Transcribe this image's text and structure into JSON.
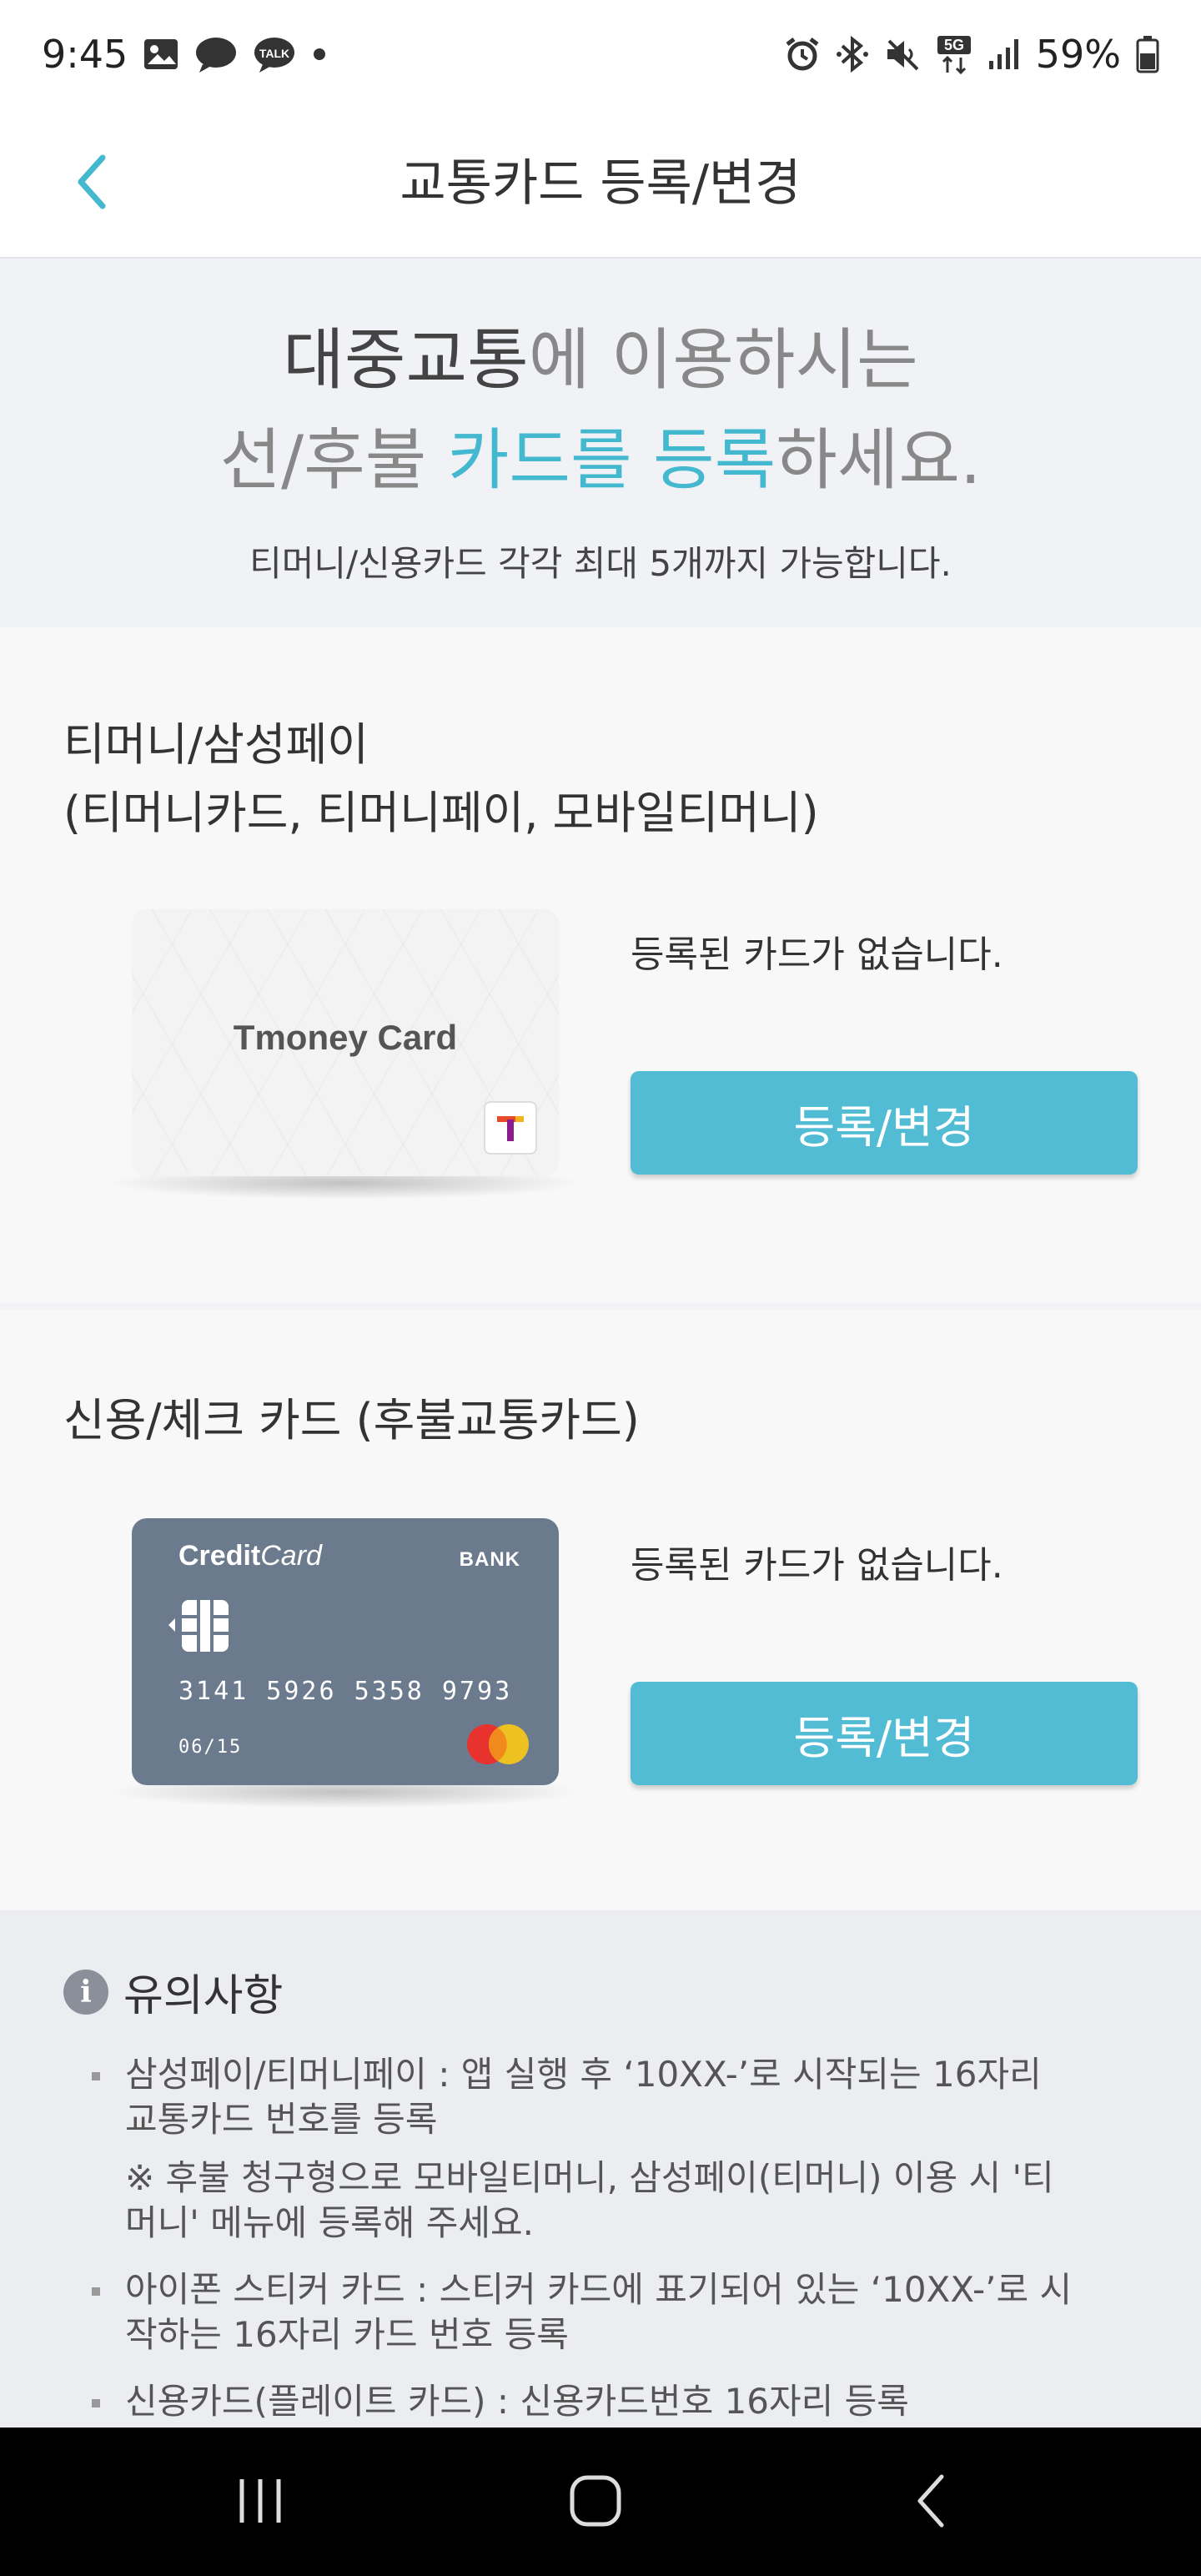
{
  "status_bar": {
    "time": "9:45",
    "battery": "59%",
    "network": "5G",
    "icons": [
      "gallery-icon",
      "chat-bubble-icon",
      "kakaotalk-icon",
      "notification-dot-icon",
      "alarm-icon",
      "bluetooth-icon",
      "mute-icon",
      "5g-icon",
      "signal-icon",
      "battery-icon"
    ],
    "talk_label": "TALK"
  },
  "app_bar": {
    "title": "교통카드 등록/변경",
    "back_icon": "chevron-left-icon",
    "accent": "#44b8cf"
  },
  "hero": {
    "line1_dark": "대중교통",
    "line1_rest": "에 이용하시는",
    "line2_a": "선/후불 ",
    "line2_teal": "카드를 등록",
    "line2_b": "하세요.",
    "sub": "티머니/신용카드 각각 최대 5개까지 가능합니다."
  },
  "tmoney": {
    "title_line1": "티머니/삼성페이",
    "title_line2": "(티머니카드, 티머니페이, 모바일티머니)",
    "card_name": "Tmoney Card",
    "status": "등록된 카드가 없습니다.",
    "button": "등록/변경"
  },
  "credit": {
    "title": "신용/체크 카드 (후불교통카드)",
    "card_brand_bold": "Credit",
    "card_brand_italic": "Card",
    "card_bank": "BANK",
    "card_number": "3141 5926 5358 9793",
    "card_expiry": "06/15",
    "status": "등록된 카드가 없습니다.",
    "button": "등록/변경"
  },
  "notice": {
    "title": "유의사항",
    "items": [
      {
        "text": "삼성페이/티머니페이 : 앱 실행 후 ‘10XX-’로 시작되는 16자리 교통카드 번호를 등록",
        "sub": "※ 후불 청구형으로 모바일티머니, 삼성페이(티머니) 이용 시 '티머니' 메뉴에 등록해 주세요."
      },
      {
        "text": "아이폰 스티커 카드 : 스티커 카드에 표기되어 있는 ‘10XX-’로 시작하는 16자리 카드 번호 등록"
      },
      {
        "text": "신용카드(플레이트 카드) : 신용카드번호 16자리 등록"
      }
    ]
  },
  "nav_bar": {
    "buttons": [
      "recent-apps-icon",
      "home-icon",
      "back-icon"
    ]
  },
  "colors": {
    "button": "#52bcd5",
    "credit_card": "#6c7a8e",
    "hero_bg": "#f1f2f6"
  }
}
